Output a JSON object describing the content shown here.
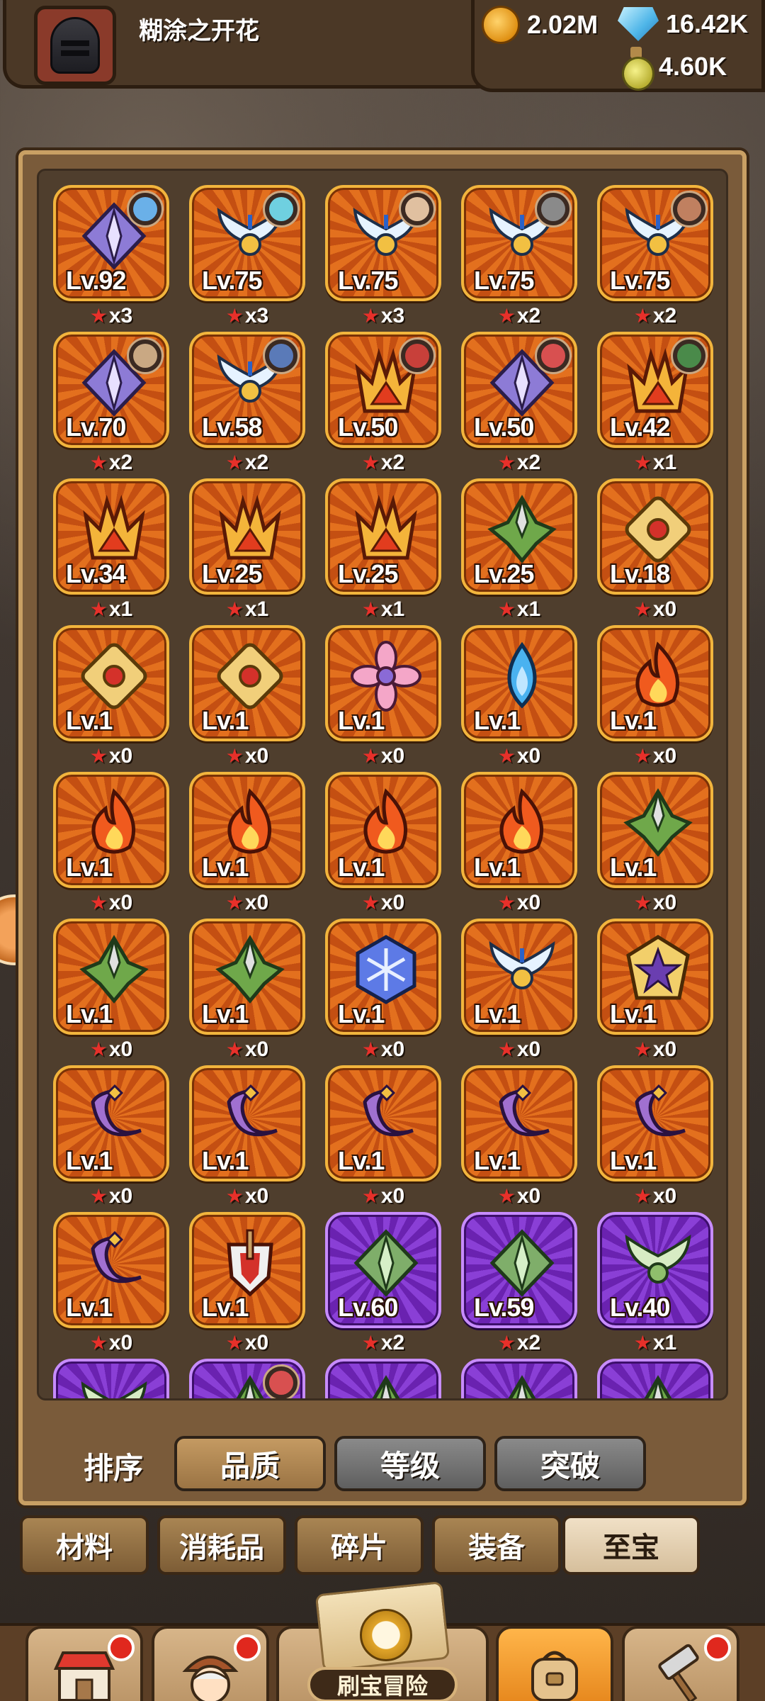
{
  "player": {
    "name": "糊涂之开花"
  },
  "currencies": [
    {
      "icon": "gold-coin-icon",
      "value": "2.02M"
    },
    {
      "icon": "diamond-gem-icon",
      "value": "16.42K"
    },
    {
      "icon": "potion-bottle-icon",
      "value": "4.60K"
    }
  ],
  "colors": {
    "tile_orange": "#e3701e",
    "tile_purple": "#8a3fd6",
    "star_red": "#e7302a",
    "active_tab": "#c49a62"
  },
  "treasures": [
    {
      "icon": "spear-diamond-icon",
      "level": "Lv.92",
      "stars": "x3",
      "rarity": "orange",
      "hero": "blue-haired-hero"
    },
    {
      "icon": "winged-emblem-icon",
      "level": "Lv.75",
      "stars": "x3",
      "rarity": "orange",
      "hero": "cyan-haired-hero"
    },
    {
      "icon": "winged-emblem-icon",
      "level": "Lv.75",
      "stars": "x3",
      "rarity": "orange",
      "hero": "dark-haired-hero"
    },
    {
      "icon": "winged-emblem-icon",
      "level": "Lv.75",
      "stars": "x2",
      "rarity": "orange",
      "hero": "knight-hero"
    },
    {
      "icon": "winged-emblem-icon",
      "level": "Lv.75",
      "stars": "x2",
      "rarity": "orange",
      "hero": "bearded-hero"
    },
    {
      "icon": "spear-diamond-icon",
      "level": "Lv.70",
      "stars": "x2",
      "rarity": "orange",
      "hero": "glasses-hero"
    },
    {
      "icon": "winged-emblem-icon",
      "level": "Lv.58",
      "stars": "x2",
      "rarity": "orange",
      "hero": "ninja-hero"
    },
    {
      "icon": "flame-crown-icon",
      "level": "Lv.50",
      "stars": "x2",
      "rarity": "orange",
      "hero": "red-demon-hero"
    },
    {
      "icon": "spear-diamond-icon",
      "level": "Lv.50",
      "stars": "x2",
      "rarity": "orange",
      "hero": "red-eyed-hero"
    },
    {
      "icon": "flame-crown-icon",
      "level": "Lv.42",
      "stars": "x1",
      "rarity": "orange",
      "hero": "green-goblin-hero"
    },
    {
      "icon": "flame-crown-icon",
      "level": "Lv.34",
      "stars": "x1",
      "rarity": "orange",
      "hero": ""
    },
    {
      "icon": "flame-crown-icon",
      "level": "Lv.25",
      "stars": "x1",
      "rarity": "orange",
      "hero": ""
    },
    {
      "icon": "flame-crown-icon",
      "level": "Lv.25",
      "stars": "x1",
      "rarity": "orange",
      "hero": ""
    },
    {
      "icon": "green-crest-icon",
      "level": "Lv.25",
      "stars": "x1",
      "rarity": "orange",
      "hero": ""
    },
    {
      "icon": "golden-shield-icon",
      "level": "Lv.18",
      "stars": "x0",
      "rarity": "orange",
      "hero": ""
    },
    {
      "icon": "golden-shield-icon",
      "level": "Lv.1",
      "stars": "x0",
      "rarity": "orange",
      "hero": ""
    },
    {
      "icon": "golden-shield-icon",
      "level": "Lv.1",
      "stars": "x0",
      "rarity": "orange",
      "hero": ""
    },
    {
      "icon": "pink-flower-icon",
      "level": "Lv.1",
      "stars": "x0",
      "rarity": "orange",
      "hero": ""
    },
    {
      "icon": "water-drop-icon",
      "level": "Lv.1",
      "stars": "x0",
      "rarity": "orange",
      "hero": ""
    },
    {
      "icon": "fire-flame-icon",
      "level": "Lv.1",
      "stars": "x0",
      "rarity": "orange",
      "hero": ""
    },
    {
      "icon": "fire-flame-icon",
      "level": "Lv.1",
      "stars": "x0",
      "rarity": "orange",
      "hero": ""
    },
    {
      "icon": "fire-flame-icon",
      "level": "Lv.1",
      "stars": "x0",
      "rarity": "orange",
      "hero": ""
    },
    {
      "icon": "fire-flame-icon",
      "level": "Lv.1",
      "stars": "x0",
      "rarity": "orange",
      "hero": ""
    },
    {
      "icon": "fire-flame-icon",
      "level": "Lv.1",
      "stars": "x0",
      "rarity": "orange",
      "hero": ""
    },
    {
      "icon": "green-crest-icon",
      "level": "Lv.1",
      "stars": "x0",
      "rarity": "orange",
      "hero": ""
    },
    {
      "icon": "green-crest-icon",
      "level": "Lv.1",
      "stars": "x0",
      "rarity": "orange",
      "hero": ""
    },
    {
      "icon": "green-crest-icon",
      "level": "Lv.1",
      "stars": "x0",
      "rarity": "orange",
      "hero": ""
    },
    {
      "icon": "snowflake-hexagon-icon",
      "level": "Lv.1",
      "stars": "x0",
      "rarity": "orange",
      "hero": ""
    },
    {
      "icon": "winged-emblem-icon",
      "level": "Lv.1",
      "stars": "x0",
      "rarity": "orange",
      "hero": ""
    },
    {
      "icon": "purple-star-badge-icon",
      "level": "Lv.1",
      "stars": "x0",
      "rarity": "orange",
      "hero": ""
    },
    {
      "icon": "crescent-moon-icon",
      "level": "Lv.1",
      "stars": "x0",
      "rarity": "orange",
      "hero": ""
    },
    {
      "icon": "crescent-moon-icon",
      "level": "Lv.1",
      "stars": "x0",
      "rarity": "orange",
      "hero": ""
    },
    {
      "icon": "crescent-moon-icon",
      "level": "Lv.1",
      "stars": "x0",
      "rarity": "orange",
      "hero": ""
    },
    {
      "icon": "crescent-moon-icon",
      "level": "Lv.1",
      "stars": "x0",
      "rarity": "orange",
      "hero": ""
    },
    {
      "icon": "crescent-moon-icon",
      "level": "Lv.1",
      "stars": "x0",
      "rarity": "orange",
      "hero": ""
    },
    {
      "icon": "crescent-moon-icon",
      "level": "Lv.1",
      "stars": "x0",
      "rarity": "orange",
      "hero": ""
    },
    {
      "icon": "sword-shield-icon",
      "level": "Lv.1",
      "stars": "x0",
      "rarity": "orange",
      "hero": ""
    },
    {
      "icon": "green-spear-diamond-icon",
      "level": "Lv.60",
      "stars": "x2",
      "rarity": "purple",
      "hero": ""
    },
    {
      "icon": "green-spear-diamond-icon",
      "level": "Lv.59",
      "stars": "x2",
      "rarity": "purple",
      "hero": ""
    },
    {
      "icon": "green-wing-emblem-icon",
      "level": "Lv.40",
      "stars": "x1",
      "rarity": "purple",
      "hero": ""
    },
    {
      "icon": "green-wing-emblem-icon",
      "level": "",
      "stars": "",
      "rarity": "purple",
      "hero": ""
    },
    {
      "icon": "green-crest-icon",
      "level": "",
      "stars": "",
      "rarity": "purple",
      "hero": "masked-hero"
    },
    {
      "icon": "green-crest-icon",
      "level": "",
      "stars": "",
      "rarity": "purple",
      "hero": ""
    },
    {
      "icon": "green-crest-icon",
      "level": "",
      "stars": "",
      "rarity": "purple",
      "hero": ""
    },
    {
      "icon": "green-crest-icon",
      "level": "",
      "stars": "",
      "rarity": "purple",
      "hero": ""
    }
  ],
  "sort": {
    "label": "排序",
    "options": [
      {
        "label": "品质",
        "active": true
      },
      {
        "label": "等级",
        "active": false
      },
      {
        "label": "突破",
        "active": false
      }
    ]
  },
  "categories": [
    {
      "label": "材料",
      "active": false
    },
    {
      "label": "消耗品",
      "active": false
    },
    {
      "label": "碎片",
      "active": false
    },
    {
      "label": "装备",
      "active": false
    },
    {
      "label": "至宝",
      "active": true
    }
  ],
  "bottom_nav": {
    "items": [
      {
        "icon": "shop-icon",
        "badge": true,
        "active": false
      },
      {
        "icon": "hero-portrait-icon",
        "badge": true,
        "active": false
      },
      {
        "icon": "backpack-icon",
        "badge": false,
        "active": true
      },
      {
        "icon": "forge-hammer-icon",
        "badge": true,
        "active": false
      }
    ],
    "center_label": "刷宝冒险"
  }
}
